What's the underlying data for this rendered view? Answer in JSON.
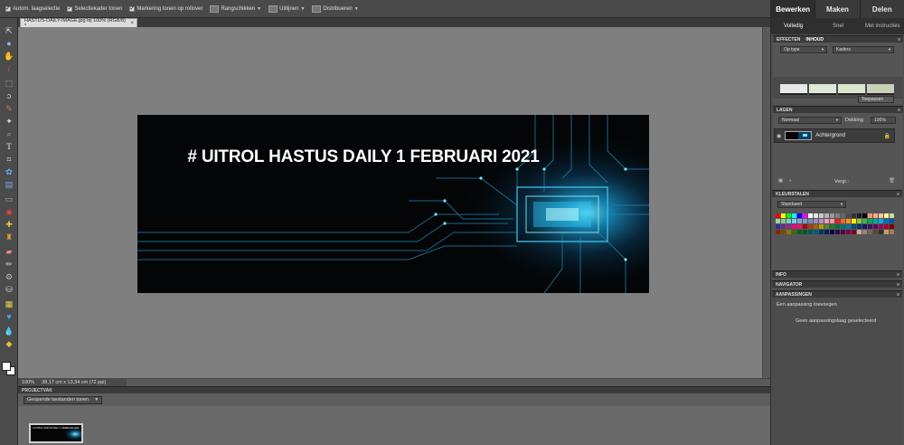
{
  "options_bar": {
    "items": [
      {
        "label": "Autom. laagselectie",
        "checked": true
      },
      {
        "label": "Selectiekader tonen",
        "checked": true
      },
      {
        "label": "Markering tonen op rollover",
        "checked": true
      },
      {
        "label": "Rangschikken"
      },
      {
        "label": "Uitlijnen"
      },
      {
        "label": "Distribueren"
      }
    ]
  },
  "document": {
    "tab_label": "HASTUS-DAILY-IMAGE.jpg bij 100% (RGB/8) *",
    "close_glyph": "×",
    "headline": "# UITROL HASTUS DAILY 1 FEBRUARI 2021"
  },
  "status": {
    "zoom": "100%",
    "dimensions": "38,17 cm x 13,34 cm (72 ppi)"
  },
  "project_bin": {
    "title": "PROJECTVAK",
    "filter_value": "Geopende bestanden tonen",
    "thumb_title": "# UITROL HASTUS DAILY 1 FEBRUARI 2021"
  },
  "right_panel": {
    "main_tabs": [
      {
        "label": "Bewerken",
        "active": true
      },
      {
        "label": "Maken",
        "active": false
      },
      {
        "label": "Delen",
        "active": false
      }
    ],
    "sub_tabs": [
      {
        "label": "Volledig",
        "active": true
      },
      {
        "label": "Snel",
        "active": false
      },
      {
        "label": "Met instructies",
        "active": false
      }
    ],
    "effects": {
      "tab_effects": "EFFECTEN",
      "tab_content": "INHOUD",
      "filter_by": "Op type",
      "category": "Kaders",
      "apply_label": "Toepassen"
    },
    "layers": {
      "title": "LAGEN",
      "blend_mode": "Normaal",
      "opacity_label": "Dekking:",
      "opacity_value": "100%",
      "layer_name": "Achtergrond",
      "lock_label": "Vergr.:"
    },
    "swatches": {
      "title": "KLEURSTALEN",
      "preset": "Standaard"
    },
    "info_title": "INFO",
    "navigator_title": "NAVIGATOR",
    "adjustments": {
      "title": "AANPASSINGEN",
      "add_text": "Een aanpassing toevoegen",
      "none_text": "Geen aanpassingslaag geselecteerd"
    }
  },
  "colors": {
    "canvas_bg": "#7f7f7f",
    "panel_bg": "#4f4f4f",
    "circuit_accent": "#1fb2e6"
  }
}
